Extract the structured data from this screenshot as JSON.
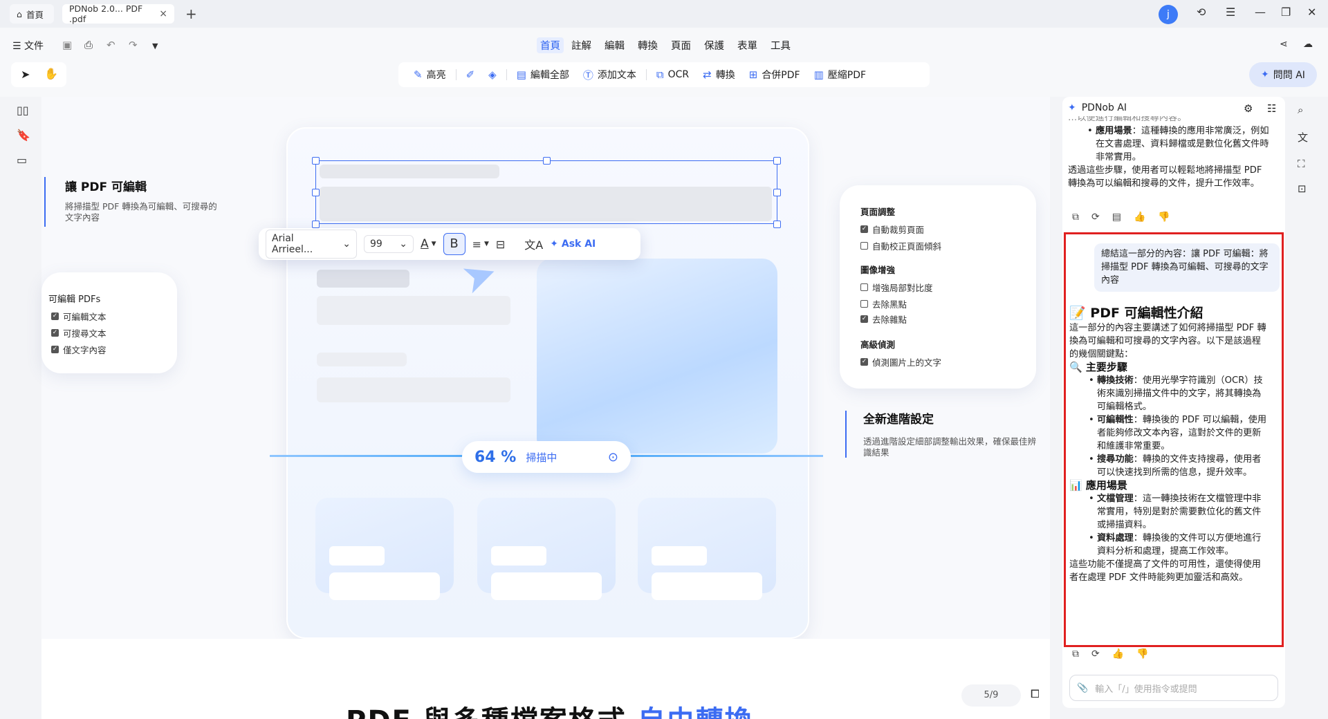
{
  "tabs": {
    "home": "首頁",
    "doc": "PDNob 2.0... PDF .pdf"
  },
  "user": {
    "avatar": "j"
  },
  "menu": {
    "file": "文件",
    "tabs": [
      "首頁",
      "註解",
      "編輯",
      "轉換",
      "頁面",
      "保護",
      "表單",
      "工具"
    ],
    "active": 0
  },
  "toolbar": {
    "tools": [
      "高亮",
      "",
      "",
      "編輯全部",
      "添加文本",
      "OCR",
      "轉換",
      "合併PDF",
      "壓縮PDF"
    ],
    "ask_ai": "問問 AI"
  },
  "canvas": {
    "feature_title": "讓 PDF 可編輯",
    "feature_desc": "將掃描型 PDF 轉換為可編輯、可搜尋的文字內容",
    "edit_card": {
      "title": "可編輯 PDFs",
      "items": [
        "可編輯文本",
        "可搜尋文本",
        "僅文字內容"
      ]
    },
    "float_toolbar": {
      "font": "Arial Arrieel...",
      "size": "99",
      "ask_ai": "Ask AI"
    },
    "scan": {
      "percent": "64 %",
      "status": "掃描中"
    },
    "right_card": {
      "page_title": "頁面調整",
      "page_items": [
        "自動裁剪頁面",
        "自動校正頁面傾斜"
      ],
      "page_checked": [
        true,
        false
      ],
      "image_title": "圖像增強",
      "image_items": [
        "增強局部對比度",
        "去除黑點",
        "去除雜點"
      ],
      "image_checked": [
        false,
        false,
        true
      ],
      "detect_title": "高級偵測",
      "detect_items": [
        "偵測圖片上的文字"
      ],
      "detect_checked": [
        true
      ]
    },
    "advanced": {
      "title": "全新進階設定",
      "desc": "透過進階設定細部調整輸出效果，確保最佳辨識結果"
    },
    "page_number": "5/9",
    "bottom_title_a": "PDF 與多種檔案格式",
    "bottom_title_b": "自由轉換"
  },
  "ai_panel": {
    "title": "PDNob AI",
    "prev": {
      "cut_line": "…以便進行編輯和搜尋內容。",
      "bullet_label": "應用場景",
      "bullet_text": "：這種轉換的應用非常廣泛，例如在文書處理、資料歸檔或是數位化舊文件時非常實用。",
      "summary": "透過這些步驟，使用者可以輕鬆地將掃描型 PDF 轉換為可以編輯和搜尋的文件，提升工作效率。"
    },
    "user_msg": "總結這一部分的內容：讓 PDF 可編輯：將掃描型 PDF 轉換為可編輯、可搜尋的文字內容",
    "answer": {
      "title": "📝 PDF 可編輯性介紹",
      "intro": "這一部分的內容主要講述了如何將掃描型 PDF 轉換為可編輯和可搜尋的文字內容。以下是該過程的幾個關鍵點：",
      "s1_title": "🔍 主要步驟",
      "s1_items": [
        {
          "label": "轉換技術",
          "text": "：使用光學字符識別（OCR）技術來識別掃描文件中的文字，將其轉換為可編輯格式。"
        },
        {
          "label": "可編輯性",
          "text": "：轉換後的 PDF 可以編輯，使用者能夠修改文本內容，這對於文件的更新和維護非常重要。"
        },
        {
          "label": "搜尋功能",
          "text": "：轉換的文件支持搜尋，使用者可以快速找到所需的信息，提升效率。"
        }
      ],
      "s2_title": "📊 應用場景",
      "s2_items": [
        {
          "label": "文檔管理",
          "text": "：這一轉換技術在文檔管理中非常實用，特別是對於需要數位化的舊文件或掃描資料。"
        },
        {
          "label": "資料處理",
          "text": "：轉換後的文件可以方便地進行資料分析和處理，提高工作效率。"
        }
      ],
      "conclusion": "這些功能不僅提高了文件的可用性，還使得使用者在處理 PDF 文件時能夠更加靈活和高效。"
    },
    "input_placeholder": "輸入「/」使用指令或提問"
  },
  "colors": {
    "accent": "#3c6cf2",
    "highlight_border": "#e02020"
  }
}
